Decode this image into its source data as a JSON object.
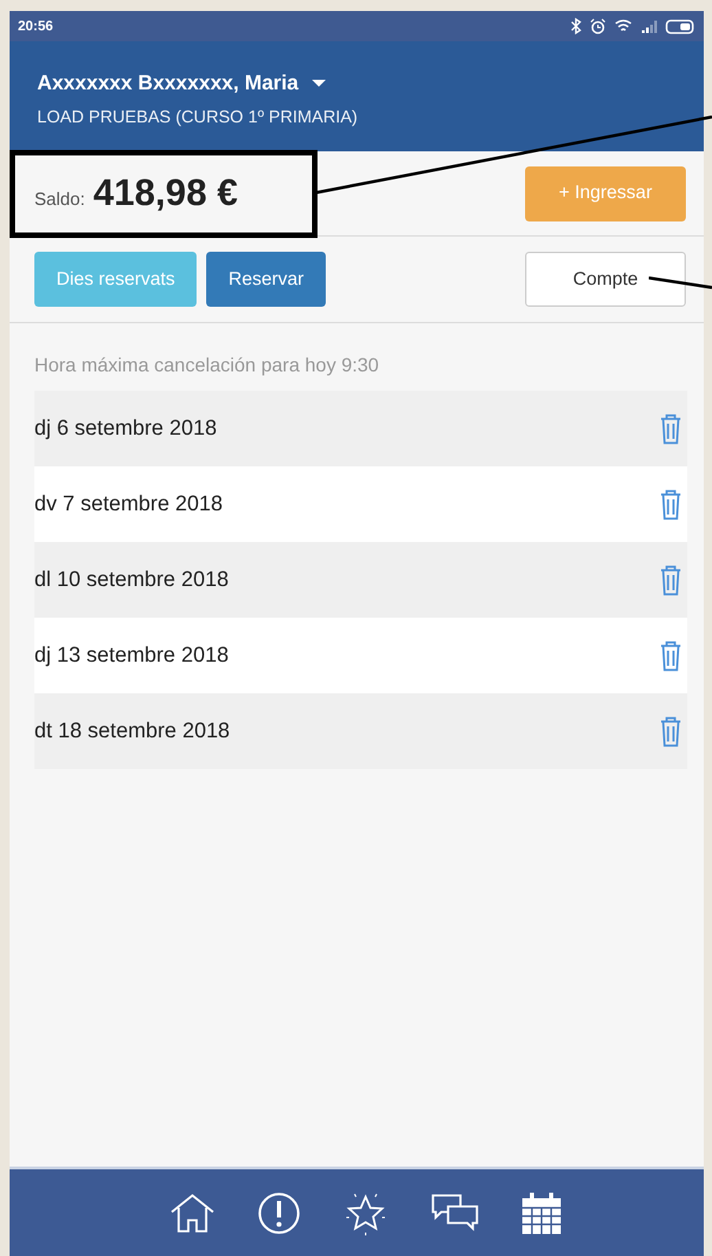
{
  "status_bar": {
    "time": "20:56"
  },
  "header": {
    "name": "Axxxxxxx Bxxxxxxx, Maria",
    "subtitle": "LOAD PRUEBAS (CURSO 1º PRIMARIA)"
  },
  "balance": {
    "label": "Saldo:",
    "amount": "418,98 €",
    "button": "+ Ingressar"
  },
  "actions": [
    {
      "label": "Dies reservats",
      "kind": "light"
    },
    {
      "label": "Reservar",
      "kind": "dark"
    },
    {
      "label": "Compte",
      "kind": "outline"
    }
  ],
  "note": "Hora máxima cancelación para hoy 9:30",
  "reservations": [
    {
      "date": "dj 6 setembre 2018"
    },
    {
      "date": "dv 7 setembre 2018"
    },
    {
      "date": "dl 10 setembre 2018"
    },
    {
      "date": "dj 13 setembre 2018"
    },
    {
      "date": "dt 18 setembre 2018"
    }
  ]
}
